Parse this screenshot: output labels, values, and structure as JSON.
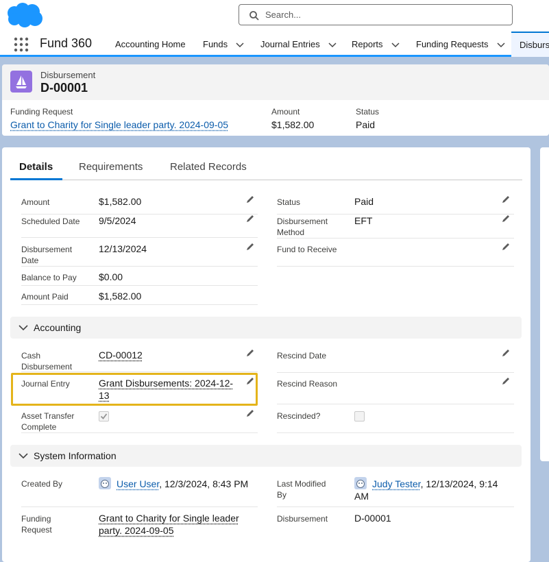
{
  "search": {
    "placeholder": "Search..."
  },
  "app": {
    "name": "Fund 360"
  },
  "nav": {
    "items": [
      {
        "label": "Accounting Home"
      },
      {
        "label": "Funds"
      },
      {
        "label": "Journal Entries"
      },
      {
        "label": "Reports"
      },
      {
        "label": "Funding Requests"
      }
    ],
    "active": "Disburs"
  },
  "record": {
    "type": "Disbursement",
    "name": "D-00001",
    "header_fields": {
      "funding_request_label": "Funding Request",
      "funding_request_value": "Grant to Charity for Single leader party. 2024-09-05",
      "amount_label": "Amount",
      "amount_value": "$1,582.00",
      "status_label": "Status",
      "status_value": "Paid"
    }
  },
  "tabs": [
    "Details",
    "Requirements",
    "Related Records"
  ],
  "details": {
    "left": [
      {
        "label": "Amount",
        "value": "$1,582.00"
      },
      {
        "label": "Scheduled Date",
        "value": "9/5/2024"
      },
      {
        "label": "Disbursement Date",
        "value": "12/13/2024"
      },
      {
        "label": "Balance to Pay",
        "value": "$0.00"
      },
      {
        "label": "Amount Paid",
        "value": "$1,582.00"
      }
    ],
    "right": [
      {
        "label": "Status",
        "value": "Paid"
      },
      {
        "label": "Disbursement Method",
        "value": "EFT"
      },
      {
        "label": "Fund to Receive",
        "value": ""
      }
    ]
  },
  "accounting": {
    "title": "Accounting",
    "cash_disbursement_label": "Cash Disbursement",
    "cash_disbursement_value": "CD-00012",
    "journal_entry_label": "Journal Entry",
    "journal_entry_value": "Grant Disbursements: 2024-12-13",
    "asset_transfer_label": "Asset Transfer Complete",
    "asset_transfer_checked": true,
    "rescind_date_label": "Rescind Date",
    "rescind_reason_label": "Rescind Reason",
    "rescinded_label": "Rescinded?",
    "rescinded_checked": false
  },
  "system": {
    "title": "System Information",
    "created_by_label": "Created By",
    "created_by_user": "User User",
    "created_by_date": ", 12/3/2024, 8:43 PM",
    "last_modified_label": "Last Modified By",
    "last_modified_user": "Judy Tester",
    "last_modified_date": ", 12/13/2024, 9:14 AM",
    "funding_request_label": "Funding Request",
    "funding_request_value": "Grant to Charity for Single leader party. 2024-09-05",
    "disbursement_label": "Disbursement",
    "disbursement_value": "D-00001"
  },
  "colors": {
    "brand": "#0176d3",
    "link": "#0b5cab",
    "record_icon": "#9371e0",
    "highlight": "#e4b41b"
  }
}
